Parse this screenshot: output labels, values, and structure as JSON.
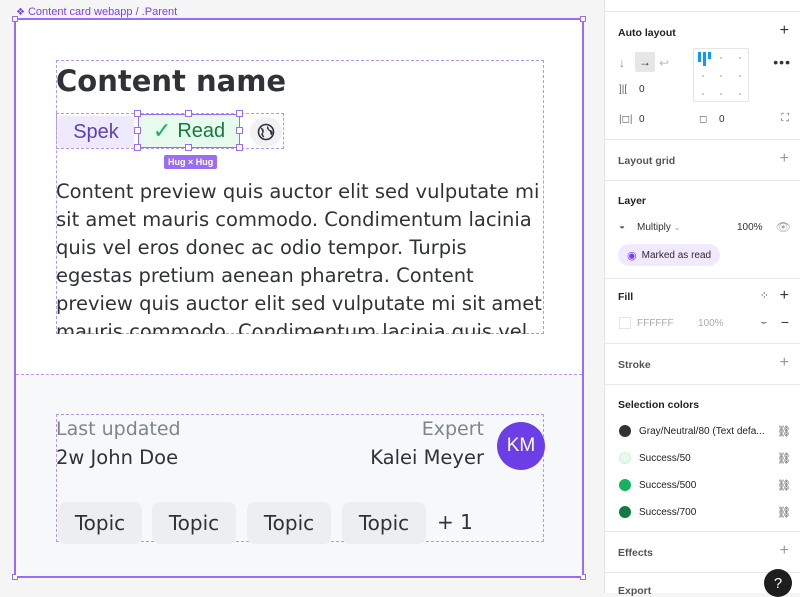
{
  "canvas": {
    "breadcrumb": "Content card webapp / .Parent",
    "card": {
      "title": "Content name",
      "chips": {
        "spek": "Spek",
        "read": "Read"
      },
      "selection_badge": "Hug × Hug",
      "preview": "Content preview quis auctor elit sed vulputate mi sit amet mauris commodo. Condimentum lacinia quis vel eros donec ac odio tempor. Turpis egestas pretium aenean pharetra. Content preview quis auctor elit sed vulputate mi sit amet mauris commodo. Condimentum lacinia quis vel eros",
      "last_updated_label": "Last updated",
      "last_updated_value": "2w John Doe",
      "expert_label": "Expert",
      "expert_value": "Kalei Meyer",
      "avatar_initials": "KM",
      "topics": [
        "Topic",
        "Topic",
        "Topic",
        "Topic"
      ],
      "more_topics": "+ 1"
    }
  },
  "panel": {
    "auto_layout": {
      "title": "Auto layout",
      "spacing": "0",
      "padding_horizontal": "0",
      "padding_vertical": "0"
    },
    "layout_grid": {
      "title": "Layout grid"
    },
    "layer": {
      "title": "Layer",
      "blend_mode": "Multiply",
      "opacity": "100%",
      "badge": "Marked as read"
    },
    "fill": {
      "title": "Fill",
      "hex": "FFFFFF",
      "opacity": "100%"
    },
    "stroke": {
      "title": "Stroke"
    },
    "selection_colors": {
      "title": "Selection colors",
      "items": [
        {
          "name": "Gray/Neutral/80 (Text defa...",
          "color": "#2f3338"
        },
        {
          "name": "Success/50",
          "color": "#e6faee"
        },
        {
          "name": "Success/500",
          "color": "#15b25f"
        },
        {
          "name": "Success/700",
          "color": "#147a42"
        }
      ]
    },
    "effects": {
      "title": "Effects"
    },
    "export": {
      "title": "Export"
    },
    "help": "?"
  }
}
